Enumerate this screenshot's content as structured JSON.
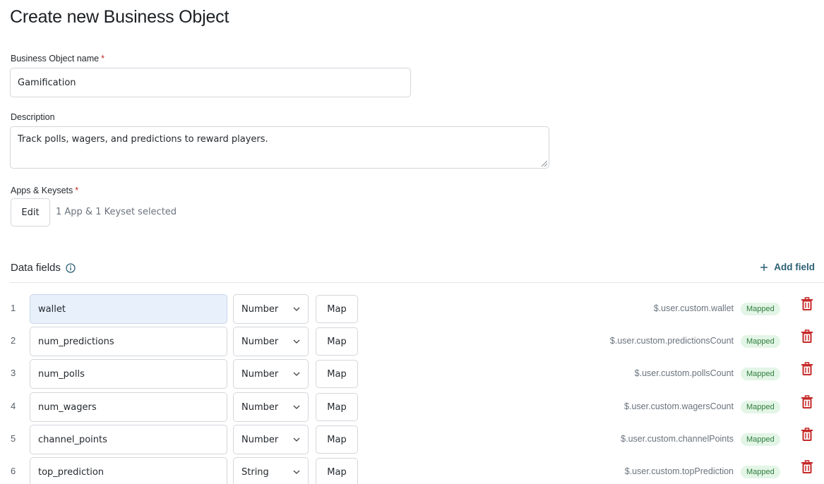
{
  "page": {
    "title": "Create new Business Object"
  },
  "form": {
    "name": {
      "label": "Business Object name",
      "required_mark": "*",
      "value": "Gamification"
    },
    "description": {
      "label": "Description",
      "value": "Track polls, wagers, and predictions to reward players."
    },
    "apps": {
      "label": "Apps & Keysets",
      "required_mark": "*",
      "edit_label": "Edit",
      "summary": "1 App & 1 Keyset selected"
    }
  },
  "data_fields": {
    "title": "Data fields",
    "add_label": "Add field",
    "colors": {
      "accent": "#2b5f74",
      "badge_bg": "#e3f5e6",
      "badge_text": "#2f7d3c",
      "delete": "#c62828",
      "focused_input_bg": "#e8f0fb"
    },
    "rows": [
      {
        "index": "1",
        "name": "wallet",
        "type": "Number",
        "map_label": "Map",
        "path": "$.user.custom.wallet",
        "status": "Mapped"
      },
      {
        "index": "2",
        "name": "num_predictions",
        "type": "Number",
        "map_label": "Map",
        "path": "$.user.custom.predictionsCount",
        "status": "Mapped"
      },
      {
        "index": "3",
        "name": "num_polls",
        "type": "Number",
        "map_label": "Map",
        "path": "$.user.custom.pollsCount",
        "status": "Mapped"
      },
      {
        "index": "4",
        "name": "num_wagers",
        "type": "Number",
        "map_label": "Map",
        "path": "$.user.custom.wagersCount",
        "status": "Mapped"
      },
      {
        "index": "5",
        "name": "channel_points",
        "type": "Number",
        "map_label": "Map",
        "path": "$.user.custom.channelPoints",
        "status": "Mapped"
      },
      {
        "index": "6",
        "name": "top_prediction",
        "type": "String",
        "map_label": "Map",
        "path": "$.user.custom.topPrediction",
        "status": "Mapped"
      }
    ]
  }
}
